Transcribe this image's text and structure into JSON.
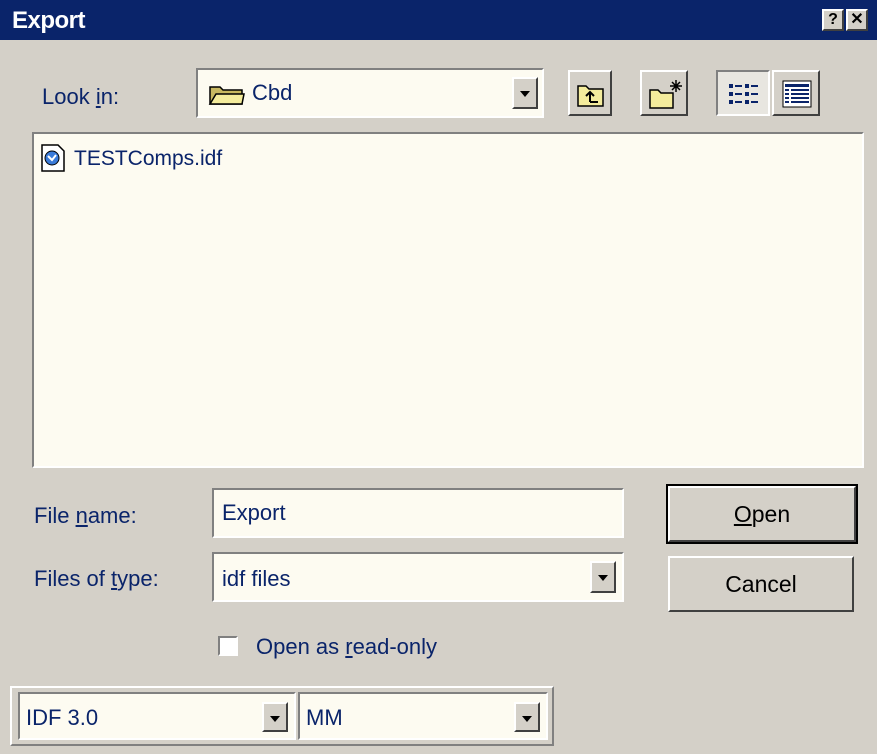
{
  "window": {
    "title": "Export",
    "help_glyph": "?",
    "close_glyph": "✕"
  },
  "lookin": {
    "label": "Look in:",
    "label_prefix": "Look ",
    "label_accel": "i",
    "label_suffix": "n:",
    "value": "Cbd",
    "icon": "folder-icon"
  },
  "toolbar": {
    "up_icon": "up-folder-icon",
    "new_icon": "new-folder-icon",
    "list_icon": "list-view-icon",
    "details_icon": "details-view-icon"
  },
  "files": [
    {
      "name": "TESTComps.idf",
      "icon": "idf-file-icon"
    }
  ],
  "filename": {
    "label_prefix": "File ",
    "label_accel": "n",
    "label_suffix": "ame:",
    "value": "Export"
  },
  "filetype": {
    "label_prefix": "Files of ",
    "label_accel": "t",
    "label_suffix": "ype:",
    "value": "idf files"
  },
  "buttons": {
    "open_accel": "O",
    "open_rest": "pen",
    "cancel": "Cancel"
  },
  "readonly": {
    "prefix": "Open as ",
    "accel": "r",
    "suffix": "ead-only",
    "checked": false
  },
  "format": {
    "version": "IDF 3.0",
    "units": "MM"
  },
  "colors": {
    "titlebar": "#0a246a",
    "dialog": "#d4d0c8",
    "field": "#fdfbf1",
    "text": "#0a246a"
  }
}
